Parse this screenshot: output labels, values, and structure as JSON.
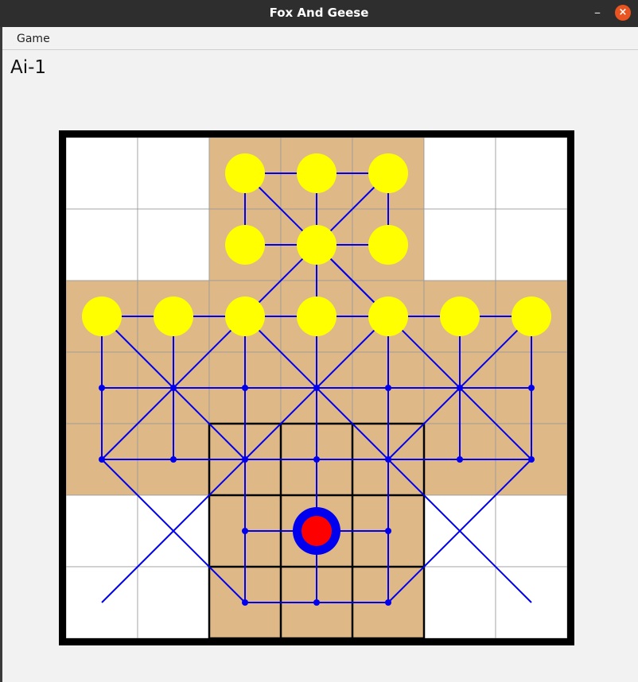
{
  "window": {
    "title": "Fox And Geese",
    "minimize_glyph": "–",
    "close_glyph": "×"
  },
  "menu": {
    "items": [
      "Game"
    ]
  },
  "status": "Ai-1",
  "colors": {
    "board_border": "#000000",
    "square_white": "#ffffff",
    "square_tan": "#deb887",
    "grid_line": "#9a9a9a",
    "path_line": "#0000ee",
    "goose": "#ffff00",
    "fox_ring": "#0000ee",
    "fox_center": "#ff0000",
    "fortress_line": "#000000"
  },
  "board": {
    "shape": "cross-7x7",
    "geese": [
      [
        2,
        0
      ],
      [
        3,
        0
      ],
      [
        4,
        0
      ],
      [
        2,
        1
      ],
      [
        3,
        1
      ],
      [
        4,
        1
      ],
      [
        0,
        2
      ],
      [
        1,
        2
      ],
      [
        2,
        2
      ],
      [
        3,
        2
      ],
      [
        4,
        2
      ],
      [
        5,
        2
      ],
      [
        6,
        2
      ]
    ],
    "fox": [
      3,
      5
    ],
    "fortress": {
      "cols": [
        2,
        5
      ],
      "rows": [
        4,
        7
      ]
    }
  }
}
